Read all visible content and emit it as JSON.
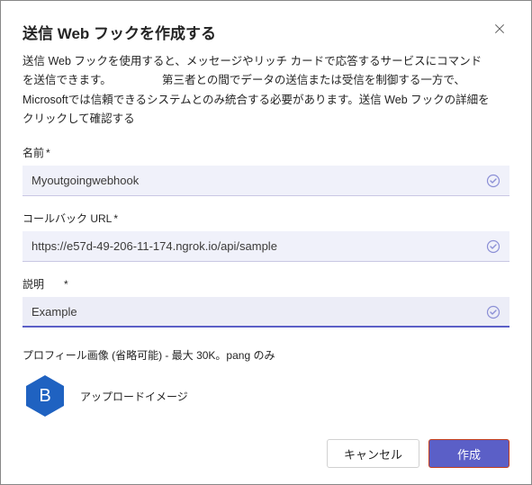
{
  "dialog": {
    "title": "送信 Web フックを作成する",
    "description": "送信 Web フックを使用すると、メッセージやリッチ カードで応答するサービスにコマンドを送信できます。　　　　　第三者との間でデータの送信または受信を制御する一方で、Microsoftでは信頼できるシステムとのみ統合する必要があります。送信 Web フックの詳細をクリックして確認する"
  },
  "fields": {
    "name": {
      "label": "名前",
      "required": "*",
      "value": "Myoutgoingwebhook"
    },
    "callback": {
      "label": "コールバック URL",
      "required": "*",
      "value": "https://e57d-49-206-11-174.ngrok.io/api/sample"
    },
    "desc": {
      "label": "説明",
      "required": "*",
      "value": "Example"
    }
  },
  "profile": {
    "label": "プロフィール画像 (省略可能) - 最大 30K。pang のみ",
    "avatar_letter": "B",
    "upload_text": "アップロードイメージ"
  },
  "footer": {
    "cancel": "キャンセル",
    "create": "作成"
  },
  "colors": {
    "accent": "#5b5fc7",
    "avatar_fill": "#1f62c1"
  }
}
